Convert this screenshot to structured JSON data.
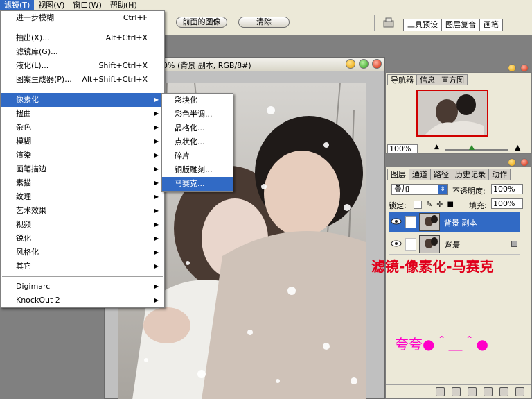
{
  "menubar": {
    "items": [
      {
        "label": "滤镜(T)",
        "active": true
      },
      {
        "label": "视图(V)",
        "active": false
      },
      {
        "label": "窗口(W)",
        "active": false
      },
      {
        "label": "帮助(H)",
        "active": false
      }
    ]
  },
  "options": {
    "front_image": "前面的图像",
    "clear": "清除"
  },
  "palette_well": {
    "tabs": [
      "工具预设",
      "图层复合",
      "画笔"
    ]
  },
  "document": {
    "title": "0% (背景 副本, RGB/8#)"
  },
  "navigator": {
    "tabs": [
      "导航器",
      "信息",
      "直方图"
    ],
    "zoom": "100%"
  },
  "layers_panel": {
    "tabs": [
      "图层",
      "通道",
      "路径",
      "历史记录",
      "动作"
    ],
    "blend_mode": "叠加",
    "opacity_label": "不透明度:",
    "opacity_value": "100%",
    "lock_label": "锁定:",
    "fill_label": "填充:",
    "fill_value": "100%",
    "layers": [
      {
        "name": "背景 副本",
        "selected": true
      },
      {
        "name": "背景",
        "selected": false
      }
    ]
  },
  "annotation": {
    "text": "滤镜-像素化-马赛克",
    "signature": "夸夸●＾＿＾●",
    "color": "#e0001c",
    "signature_color": "#ff00c8"
  },
  "filter_menu": {
    "top": [
      {
        "label": "进一步模糊",
        "shortcut": "Ctrl+F"
      }
    ],
    "group2": [
      {
        "label": "抽出(X)...",
        "shortcut": "Alt+Ctrl+X"
      },
      {
        "label": "滤镜库(G)...",
        "shortcut": ""
      },
      {
        "label": "液化(L)...",
        "shortcut": "Shift+Ctrl+X"
      },
      {
        "label": "图案生成器(P)...",
        "shortcut": "Alt+Shift+Ctrl+X"
      }
    ],
    "group3": [
      "像素化",
      "扭曲",
      "杂色",
      "模糊",
      "渲染",
      "画笔描边",
      "素描",
      "纹理",
      "艺术效果",
      "视频",
      "锐化",
      "风格化",
      "其它"
    ],
    "group4": [
      "Digimarc",
      "KnockOut 2"
    ],
    "highlighted": "像素化"
  },
  "pixelate_submenu": {
    "items": [
      "彩块化",
      "彩色半调...",
      "晶格化...",
      "点状化...",
      "碎片",
      "铜版雕刻...",
      "马赛克..."
    ],
    "highlighted": "马赛克..."
  },
  "colors": {
    "highlight": "#316ac5",
    "ui_bg": "#ece9d8"
  }
}
